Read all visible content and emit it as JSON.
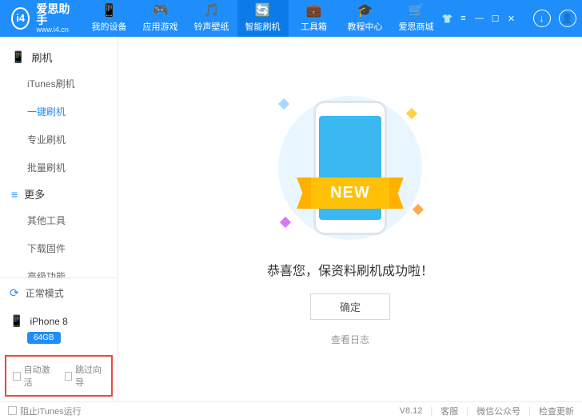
{
  "brand": {
    "name": "爱思助手",
    "domain": "www.i4.cn"
  },
  "nav": {
    "items": [
      {
        "label": "我的设备",
        "icon": "📱"
      },
      {
        "label": "应用游戏",
        "icon": "🎮"
      },
      {
        "label": "铃声壁纸",
        "icon": "🎵"
      },
      {
        "label": "智能刷机",
        "icon": "🔄"
      },
      {
        "label": "工具箱",
        "icon": "💼"
      },
      {
        "label": "教程中心",
        "icon": "🎓"
      },
      {
        "label": "爱思商城",
        "icon": "🛒"
      }
    ],
    "active_index": 3
  },
  "sidebar": {
    "groups": [
      {
        "title": "刷机",
        "icon": "📱",
        "items": [
          "iTunes刷机",
          "一键刷机",
          "专业刷机",
          "批量刷机"
        ],
        "active_index": 1
      },
      {
        "title": "更多",
        "icon": "≡",
        "items": [
          "其他工具",
          "下载固件",
          "高级功能"
        ],
        "active_index": -1
      }
    ],
    "mode": {
      "label": "正常模式",
      "icon": "⟳"
    },
    "device": {
      "name": "iPhone 8",
      "icon": "📱",
      "storage": "64GB"
    },
    "options": {
      "auto_activate": "自动激活",
      "skip_guide": "跳过向导"
    }
  },
  "main": {
    "ribbon": "NEW",
    "message": "恭喜您，保资料刷机成功啦！",
    "ok": "确定",
    "view_log": "查看日志"
  },
  "status": {
    "block_itunes": "阻止iTunes运行",
    "version": "V8.12",
    "support": "客服",
    "wechat": "微信公众号",
    "check_update": "检查更新"
  }
}
